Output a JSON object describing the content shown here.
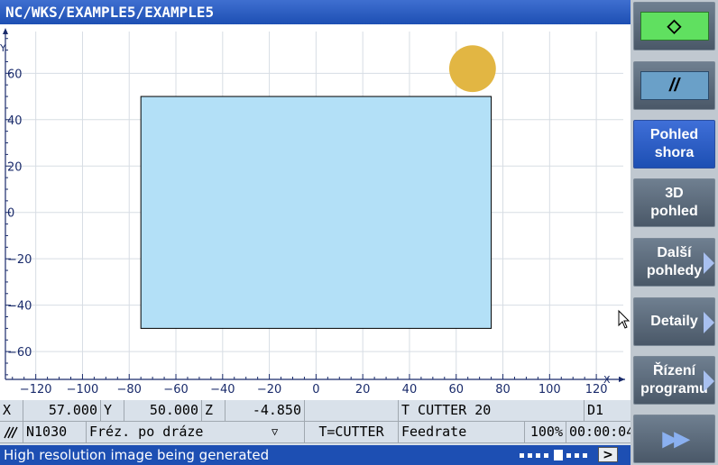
{
  "title": "NC/WKS/EXAMPLE5/EXAMPLE5",
  "sim": {
    "axis_x_name": "X",
    "axis_y_name": "Y",
    "x_ticks": [
      "-120",
      "-100",
      "-80",
      "-60",
      "-40",
      "-20",
      "0",
      "20",
      "40",
      "60",
      "80",
      "100",
      "120"
    ],
    "y_ticks": [
      "60",
      "40",
      "20",
      "0",
      "-20",
      "-40",
      "-60"
    ],
    "x_range": [
      -133,
      130
    ],
    "y_range": [
      -72,
      78
    ],
    "workpiece": {
      "x_min": -75,
      "x_max": 75,
      "y_min": -50,
      "y_max": 50,
      "color": "#b3e0f7"
    },
    "tool": {
      "x": 67,
      "y": 62,
      "radius": 10,
      "color": "#e2b643"
    }
  },
  "status": {
    "x_label": "X",
    "x_value": "57.000",
    "y_label": "Y",
    "y_value": "50.000",
    "z_label": "Z",
    "z_value": "-4.850",
    "tool": "T CUTTER 20",
    "d_number": "D1",
    "block": "N1030",
    "operation": "Fréz. po dráze",
    "operation_arrow": "▽",
    "tool_type": "T=CUTTER",
    "feedrate_label": "Feedrate",
    "override": "100%",
    "time": "00:00:04"
  },
  "message": "High resolution image being generated",
  "play_label": ">",
  "softkeys": [
    {
      "name": "cycle-start",
      "label": "◇"
    },
    {
      "name": "reset",
      "label": "//"
    },
    {
      "name": "top-view",
      "label": "Pohled shora"
    },
    {
      "name": "3d-view",
      "label": "3D pohled"
    },
    {
      "name": "other-views",
      "label": "Další pohledy"
    },
    {
      "name": "details",
      "label": "Detaily"
    },
    {
      "name": "program-control",
      "label": "Řízení programu"
    },
    {
      "name": "fast-forward",
      "label": "▶▶"
    }
  ]
}
